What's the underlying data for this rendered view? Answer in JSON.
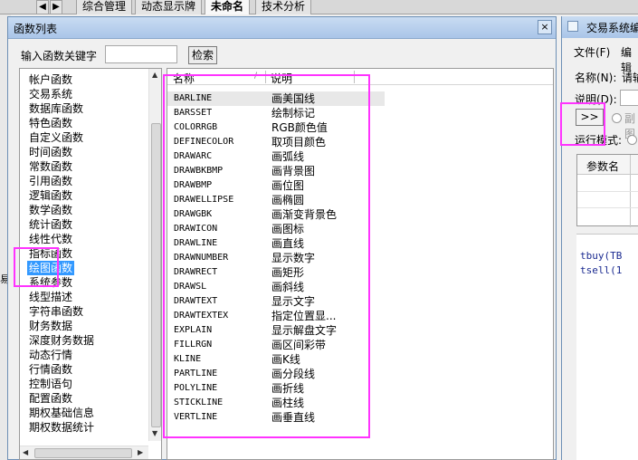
{
  "background": {
    "left_fragment": "易",
    "tabs": [
      "综合管理",
      "动态显示牌",
      "未命名",
      "技术分析"
    ],
    "active_tab": "未命名",
    "nav_icons": [
      "chevron-left-icon",
      "chevron-right-icon"
    ]
  },
  "dialog": {
    "title": "函数列表",
    "close_glyph": "×",
    "search": {
      "label": "输入函数关键字",
      "value": "",
      "button": "检索"
    },
    "categories": [
      {
        "label": "帐户函数"
      },
      {
        "label": "交易系统"
      },
      {
        "label": "数据库函数"
      },
      {
        "label": "特色函数"
      },
      {
        "label": "自定义函数"
      },
      {
        "label": "时间函数"
      },
      {
        "label": "常数函数"
      },
      {
        "label": "引用函数"
      },
      {
        "label": "逻辑函数"
      },
      {
        "label": "数学函数"
      },
      {
        "label": "统计函数"
      },
      {
        "label": "线性代数"
      },
      {
        "label": "指标函数"
      },
      {
        "label": "绘图函数",
        "selected": true
      },
      {
        "label": "系统参数"
      },
      {
        "label": "线型描述"
      },
      {
        "label": "字符串函数"
      },
      {
        "label": "财务数据"
      },
      {
        "label": "深度财务数据"
      },
      {
        "label": "动态行情"
      },
      {
        "label": "行情函数"
      },
      {
        "label": "控制语句"
      },
      {
        "label": "配置函数"
      },
      {
        "label": "期权基础信息"
      },
      {
        "label": "期权数据统计"
      }
    ],
    "table": {
      "columns": [
        "名称",
        "说明"
      ],
      "sort_indicator": "/",
      "rows": [
        {
          "name": "BARLINE",
          "desc": "画美国线",
          "selected": true
        },
        {
          "name": "BARSSET",
          "desc": "绘制标记"
        },
        {
          "name": "COLORRGB",
          "desc": "RGB颜色值"
        },
        {
          "name": "DEFINECOLOR",
          "desc": "取项目颜色"
        },
        {
          "name": "DRAWARC",
          "desc": "画弧线"
        },
        {
          "name": "DRAWBKBMP",
          "desc": "画背景图"
        },
        {
          "name": "DRAWBMP",
          "desc": "画位图"
        },
        {
          "name": "DRAWELLIPSE",
          "desc": "画椭圆"
        },
        {
          "name": "DRAWGBK",
          "desc": "画渐变背景色"
        },
        {
          "name": "DRAWICON",
          "desc": "画图标"
        },
        {
          "name": "DRAWLINE",
          "desc": "画直线"
        },
        {
          "name": "DRAWNUMBER",
          "desc": "显示数字"
        },
        {
          "name": "DRAWRECT",
          "desc": "画矩形"
        },
        {
          "name": "DRAWSL",
          "desc": "画斜线"
        },
        {
          "name": "DRAWTEXT",
          "desc": "显示文字"
        },
        {
          "name": "DRAWTEXTEX",
          "desc": "指定位置显..."
        },
        {
          "name": "EXPLAIN",
          "desc": "显示解盘文字"
        },
        {
          "name": "FILLRGN",
          "desc": "画区间彩带"
        },
        {
          "name": "KLINE",
          "desc": "画K线"
        },
        {
          "name": "PARTLINE",
          "desc": "画分段线"
        },
        {
          "name": "POLYLINE",
          "desc": "画折线"
        },
        {
          "name": "STICKLINE",
          "desc": "画柱线"
        },
        {
          "name": "VERTLINE",
          "desc": "画垂直线"
        }
      ]
    },
    "scroll_arrows": {
      "up": "▲",
      "down": "▼",
      "left": "◀",
      "right": "▶"
    }
  },
  "system_window": {
    "title": "交易系统编",
    "menu": [
      "文件(F)",
      "编辑"
    ],
    "name_label": "名称(N):",
    "name_value": "请输",
    "desc_label": "说明(D):",
    "arrow_button": ">>",
    "radio_label": "副图",
    "run_mode_label": "运行模式:",
    "param_header": "参数名",
    "code_lines": [
      "tbuy(TB",
      "tsell(1"
    ]
  },
  "colors": {
    "highlight": "#ff33ff",
    "selection": "#3399ff",
    "title_bar": "#a9c5e8"
  }
}
